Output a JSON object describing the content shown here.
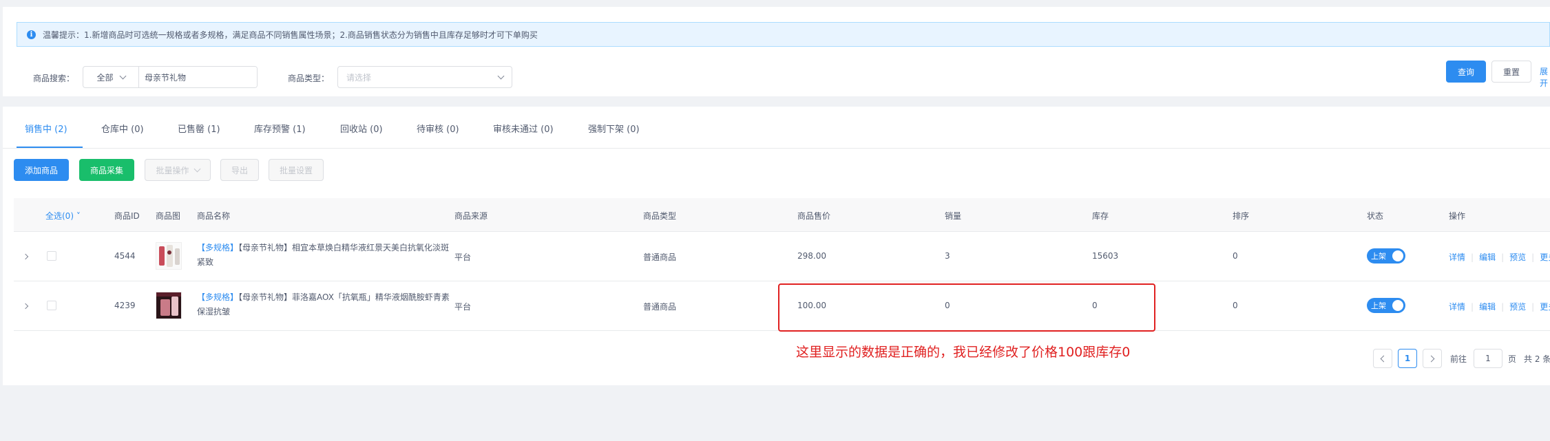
{
  "notice": {
    "text": "温馨提示：1.新增商品时可选统一规格或者多规格，满足商品不同销售属性场景；2.商品销售状态分为销售中且库存足够时才可下单购买"
  },
  "search": {
    "label": "商品搜索：",
    "scope_value": "全部",
    "keyword_value": "母亲节礼物",
    "type_label": "商品类型：",
    "type_placeholder": "请选择",
    "query_button": "查询",
    "reset_button": "重置",
    "expand_link": "展开"
  },
  "tabs": [
    {
      "label": "销售中 (2)",
      "active": true
    },
    {
      "label": "仓库中 (0)"
    },
    {
      "label": "已售罄 (1)"
    },
    {
      "label": "库存预警 (1)"
    },
    {
      "label": "回收站 (0)"
    },
    {
      "label": "待审核 (0)"
    },
    {
      "label": "审核未通过 (0)"
    },
    {
      "label": "强制下架 (0)"
    }
  ],
  "toolbar": {
    "add": "添加商品",
    "collect": "商品采集",
    "batch": "批量操作",
    "export": "导出",
    "batch_settings": "批量设置"
  },
  "table": {
    "columns": {
      "select_all": "全选(0)",
      "id": "商品ID",
      "image": "商品图",
      "name": "商品名称",
      "source": "商品来源",
      "type": "商品类型",
      "price": "商品售价",
      "sales": "销量",
      "stock": "库存",
      "sort": "排序",
      "status": "状态",
      "actions": "操作"
    },
    "rows": [
      {
        "id": "4544",
        "tag": "【多规格】",
        "name": "【母亲节礼物】相宜本草焕白精华液红景天美白抗氧化淡斑紧致",
        "source": "平台",
        "type": "普通商品",
        "price": "298.00",
        "sales": "3",
        "stock": "15603",
        "sort": "0",
        "status": "上架"
      },
      {
        "id": "4239",
        "tag": "【多规格】",
        "name": "【母亲节礼物】菲洛嘉AOX「抗氧瓶」精华液烟酰胺虾青素保湿抗皱",
        "source": "平台",
        "type": "普通商品",
        "price": "100.00",
        "sales": "0",
        "stock": "0",
        "sort": "0",
        "status": "上架"
      }
    ],
    "actions": [
      "详情",
      "编辑",
      "预览",
      "更多"
    ]
  },
  "annotation": "这里显示的数据是正确的，我已经修改了价格100跟库存0",
  "pagination": {
    "current": "1",
    "goto_label": "前往",
    "goto_value": "1",
    "page_unit": "页",
    "total": "共 2 条"
  },
  "colors": {
    "primary": "#2d8cf0",
    "success": "#19be6b",
    "annotation": "#e02020"
  }
}
